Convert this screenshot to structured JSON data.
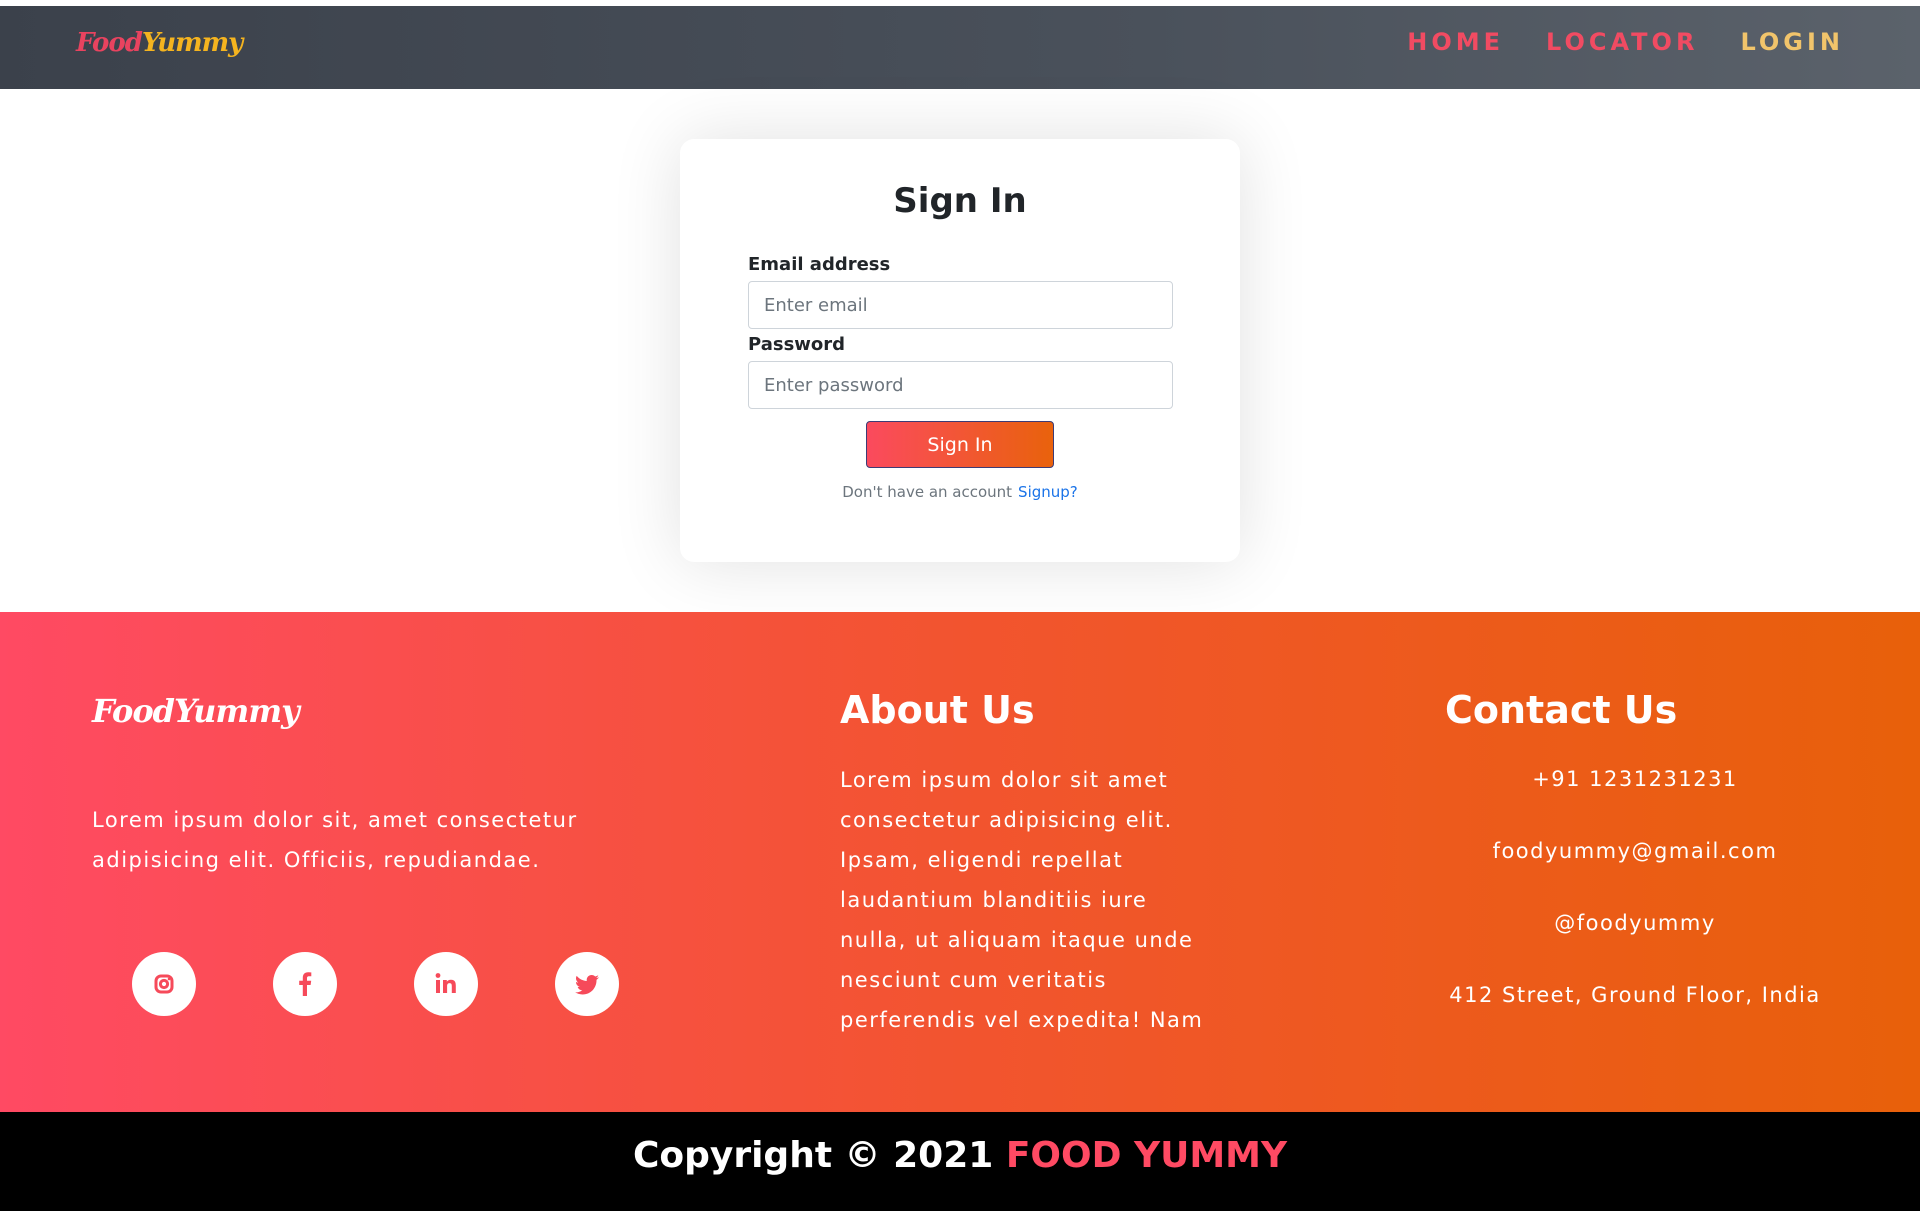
{
  "header": {
    "brand_part1": "Food",
    "brand_part2": "Yummy",
    "nav": {
      "home": "HOME",
      "locator": "LOCATOR",
      "login": "LOGIN"
    }
  },
  "signin": {
    "title": "Sign In",
    "email_label": "Email address",
    "email_placeholder": "Enter email",
    "email_value": "",
    "password_label": "Password",
    "password_placeholder": "Enter password",
    "password_value": "",
    "button_label": "Sign In",
    "no_account_text": "Don't have an account",
    "signup_link": "Signup?"
  },
  "footer": {
    "brand_part1": "Food",
    "brand_part2": "Yummy",
    "description": "Lorem ipsum dolor sit, amet consectetur adipisicing elit. Officiis, repudiandae.",
    "socials": [
      "instagram-icon",
      "facebook-icon",
      "linkedin-icon",
      "twitter-icon"
    ],
    "about": {
      "heading": "About Us",
      "text": "Lorem ipsum dolor sit amet consectetur adipisicing elit. Ipsam, eligendi repellat laudantium blanditiis iure nulla, ut aliquam itaque unde nesciunt cum veritatis perferendis vel expedita! Nam"
    },
    "contact": {
      "heading": "Contact Us",
      "phone": "+91 1231231231",
      "email": "foodyummy@gmail.com",
      "handle": "@foodyummy",
      "address": "412 Street, Ground Floor, India"
    }
  },
  "copyright": {
    "text": "Copyright © 2021 ",
    "brand": "FOOD YUMMY"
  },
  "colors": {
    "accent_red": "#ff4a63",
    "accent_orange": "#e8600a",
    "nav_login": "#f1c46b",
    "link_blue": "#1a73e8"
  }
}
